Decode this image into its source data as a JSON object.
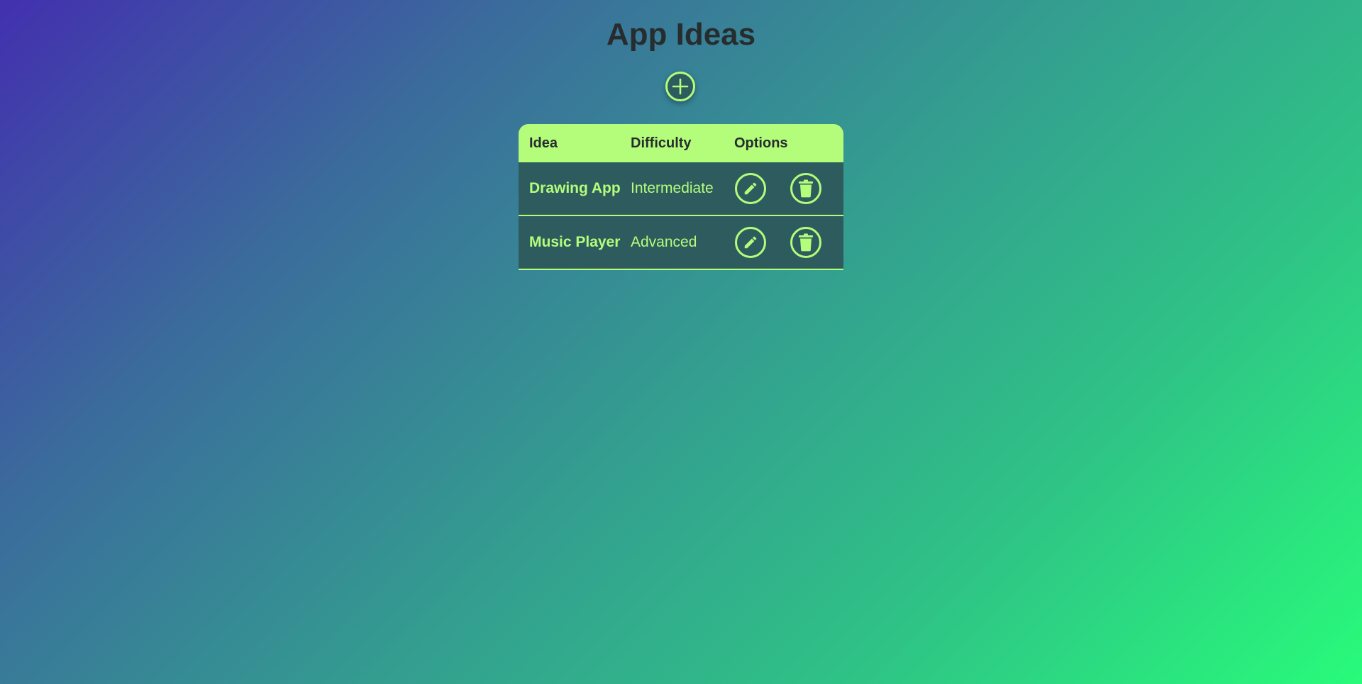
{
  "page": {
    "title": "App Ideas"
  },
  "actions": {
    "add_icon": "plus-icon"
  },
  "table": {
    "headers": {
      "idea": "Idea",
      "difficulty": "Difficulty",
      "options": "Options"
    },
    "rows": [
      {
        "idea": "Drawing App",
        "difficulty": "Intermediate"
      },
      {
        "idea": "Music Player",
        "difficulty": "Advanced"
      }
    ],
    "row_icons": [
      "pencil-icon",
      "trash-icon"
    ]
  },
  "colors": {
    "accent": "#b3fd7b",
    "text_dark": "#272d2f",
    "row_background": "#2e5c5e",
    "gradient_start": "#4330af",
    "gradient_end": "#28fb7a"
  }
}
